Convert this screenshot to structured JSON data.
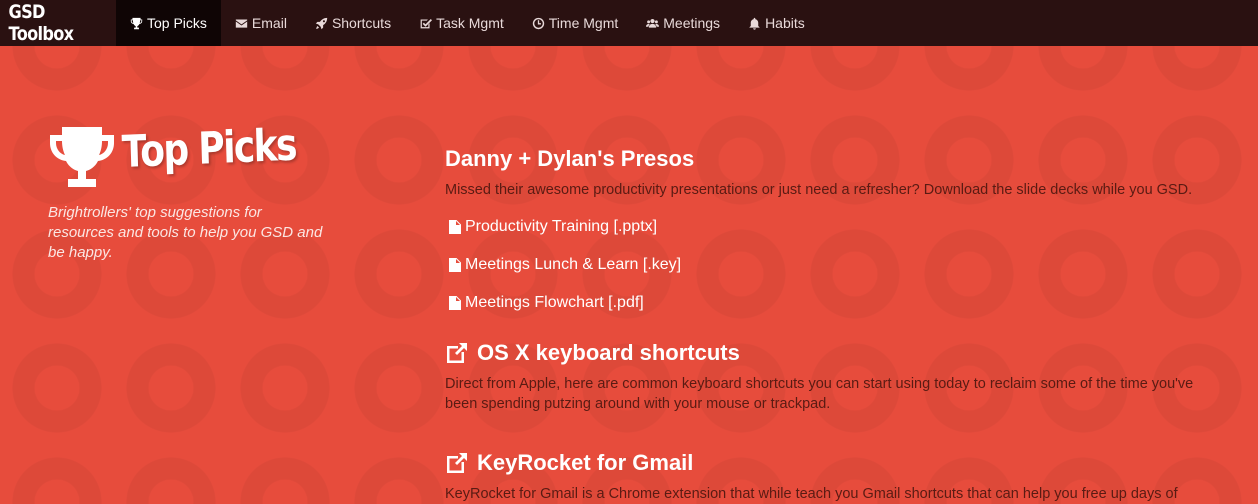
{
  "brand": "GSD Toolbox",
  "nav": [
    {
      "label": "Top Picks",
      "icon": "trophy-icon",
      "active": true
    },
    {
      "label": "Email",
      "icon": "envelope-icon"
    },
    {
      "label": "Shortcuts",
      "icon": "rocket-icon"
    },
    {
      "label": "Task Mgmt",
      "icon": "checkbox-icon"
    },
    {
      "label": "Time Mgmt",
      "icon": "clock-icon"
    },
    {
      "label": "Meetings",
      "icon": "users-icon"
    },
    {
      "label": "Habits",
      "icon": "bell-icon"
    }
  ],
  "hero": {
    "title": "Top Picks",
    "tagline": "Brightrollers' top suggestions for resources and tools to help you GSD and be happy."
  },
  "sections": [
    {
      "title": "Danny + Dylan's Presos",
      "description": "Missed their awesome productivity presentations or just need a refresher? Download the slide decks while you GSD.",
      "files": [
        "Productivity Training [.pptx]",
        "Meetings Lunch & Learn [.key]",
        "Meetings Flowchart [.pdf]"
      ]
    },
    {
      "title": "OS X keyboard shortcuts",
      "icon": "external-link-icon",
      "description": "Direct from Apple, here are common keyboard shortcuts you can start using today to reclaim some of the time you've been spending putzing around with your mouse or trackpad."
    },
    {
      "title": "KeyRocket for Gmail",
      "icon": "external-link-icon",
      "description": "KeyRocket for Gmail is a Chrome extension that while teach you Gmail shortcuts that can help you free up days of"
    }
  ],
  "colors": {
    "background": "#e74c3c",
    "navbar": "#2a1111",
    "nav_active": "#0f0505",
    "desc_text": "#5a1b13"
  }
}
